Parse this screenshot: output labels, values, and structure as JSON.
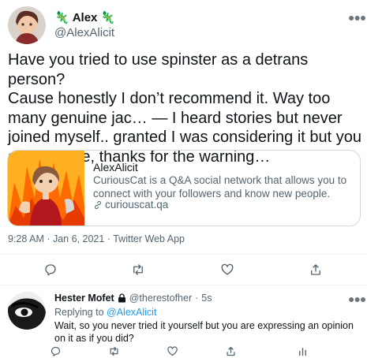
{
  "tweet": {
    "author_name": "Alex",
    "handle": "@AlexAlicit",
    "text": "Have you tried to use spinster as a detrans person?\nCause honestly I don’t recommend it. Way too many genuine jac… — I heard stories but never joined myself.. granted I was considering it but you stopped me, thanks for the warning…",
    "time": "9:28 AM",
    "date": "Jan 6, 2021",
    "source": "Twitter Web App",
    "more_icon": "more-dots-icon"
  },
  "card": {
    "title": "AlexAlicit",
    "description": "CuriousCat is a Q&A social network that allows you to connect with your followers and know new people.",
    "url": "curiouscat.qa",
    "link_icon": "link-icon"
  },
  "actions": [
    "reply-icon",
    "retweet-icon",
    "like-icon",
    "share-icon"
  ],
  "reply": {
    "author_name": "Hester Mofet",
    "handle": "@therestofher",
    "time": "5s",
    "replying_prefix": "Replying to",
    "replying_to": "@AlexAlicit",
    "text": "Wait, so you never tried it yourself but you are expressing an opinion on it as if you did?",
    "actions": [
      "reply-icon",
      "retweet-icon",
      "like-icon",
      "share-icon",
      "analytics-icon"
    ]
  },
  "colors": {
    "accent": "#1d9bf0",
    "muted": "#536471",
    "border": "#cfd9de",
    "lizard": "#2fa84f"
  }
}
